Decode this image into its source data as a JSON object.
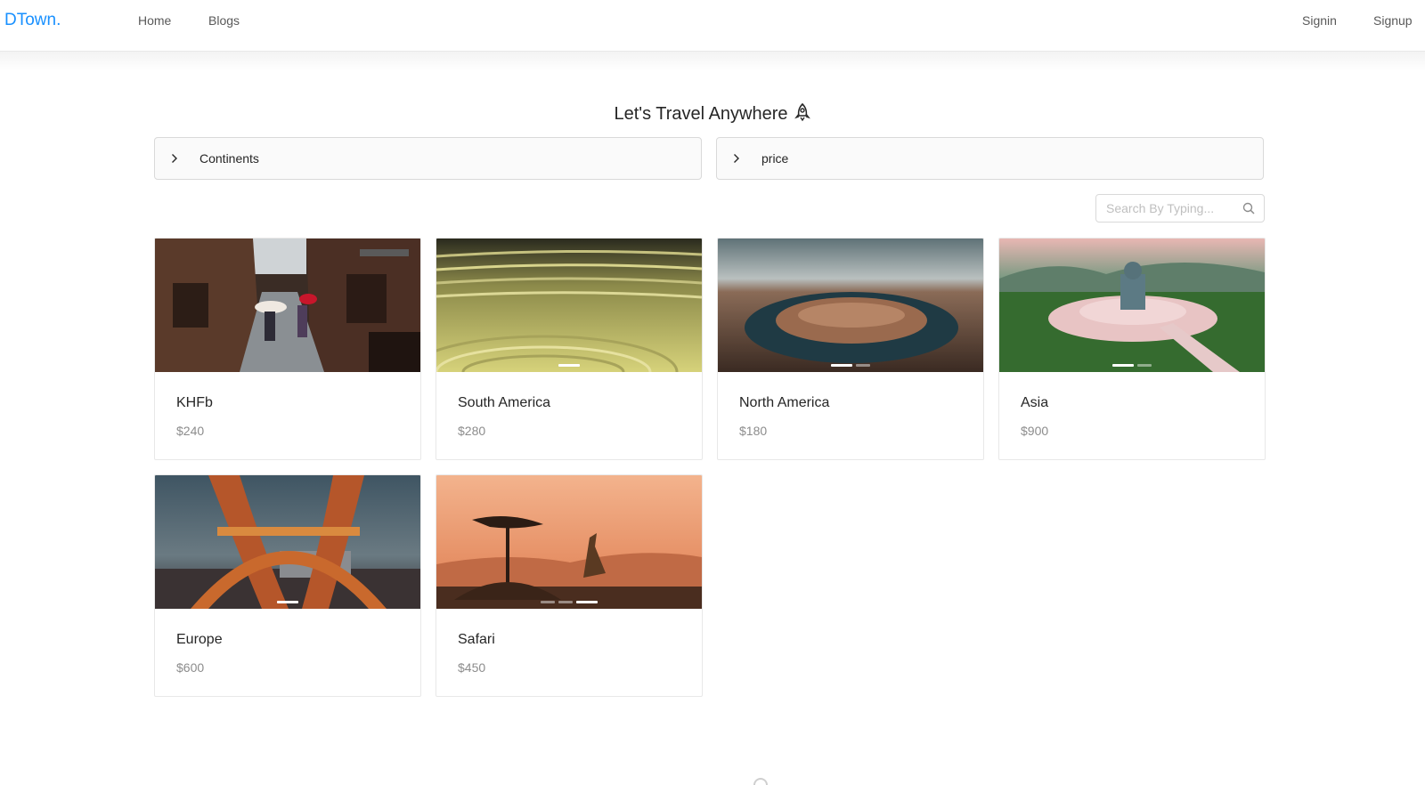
{
  "header": {
    "logo": "DTown.",
    "nav": [
      {
        "label": "Home"
      },
      {
        "label": "Blogs"
      }
    ],
    "auth": [
      {
        "label": "Signin"
      },
      {
        "label": "Signup"
      }
    ]
  },
  "main": {
    "title": "Let's Travel Anywhere",
    "filters": [
      {
        "label": "Continents"
      },
      {
        "label": "price"
      }
    ],
    "search": {
      "placeholder": "Search By Typing..."
    },
    "cards": [
      {
        "name": "KHFb",
        "price": "$240"
      },
      {
        "name": "South America",
        "price": "$280"
      },
      {
        "name": "North America",
        "price": "$180"
      },
      {
        "name": "Asia",
        "price": "$900"
      },
      {
        "name": "Europe",
        "price": "$600"
      },
      {
        "name": "Safari",
        "price": "$450"
      }
    ]
  },
  "colors": {
    "brand": "#1890ff",
    "border": "#d9d9d9",
    "muted": "#8c8c8c",
    "panel": "#fafafa"
  },
  "icons": [
    "right-chevron-icon",
    "rocket-icon",
    "search-icon"
  ]
}
